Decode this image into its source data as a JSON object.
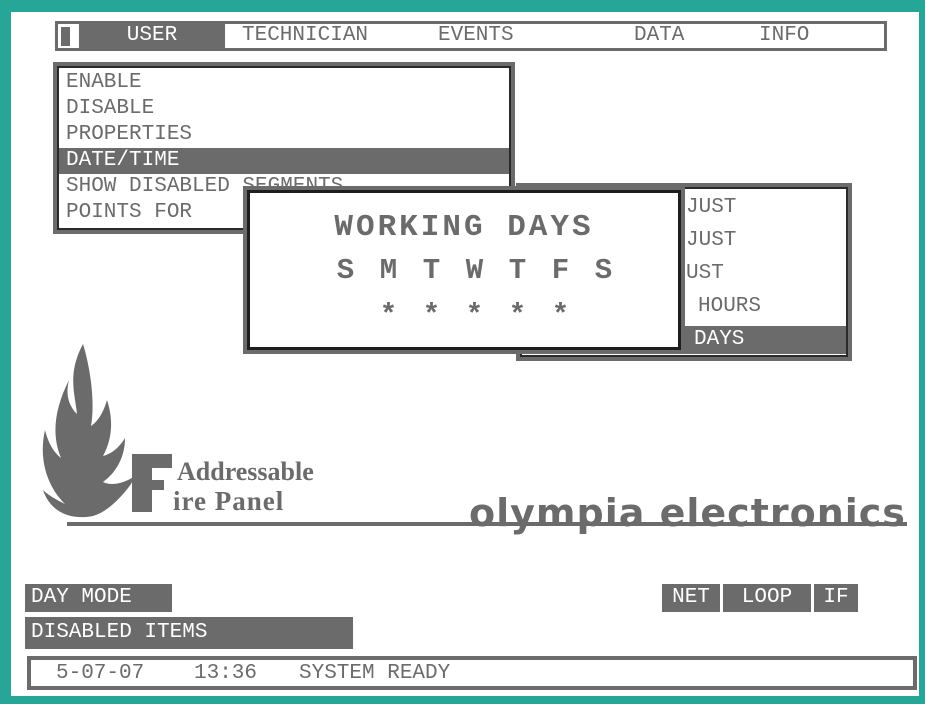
{
  "menu": {
    "items": [
      {
        "label": "USER",
        "active": true
      },
      {
        "label": "TECHNICIAN",
        "active": false
      },
      {
        "label": "EVENTS",
        "active": false
      },
      {
        "label": "DATA",
        "active": false
      },
      {
        "label": "INFO",
        "active": false
      }
    ]
  },
  "user_menu": {
    "items": [
      {
        "label": "ENABLE"
      },
      {
        "label": "DISABLE"
      },
      {
        "label": "PROPERTIES"
      },
      {
        "label": "DATE/TIME",
        "selected": true
      },
      {
        "label": "SHOW DISABLED SEGMENTS"
      },
      {
        "label": "POINTS FOR"
      }
    ]
  },
  "datetime_submenu": {
    "items": [
      {
        "label": "JUST"
      },
      {
        "label": "JUST"
      },
      {
        "label": "UST"
      },
      {
        "label": "HOURS"
      },
      {
        "label": "DAYS",
        "selected": true
      }
    ]
  },
  "working_days_dialog": {
    "title": "WORKING DAYS",
    "days": [
      "S",
      "M",
      "T",
      "W",
      "T",
      "F",
      "S"
    ],
    "marks": [
      "",
      "*",
      "*",
      "*",
      "*",
      "*",
      ""
    ]
  },
  "logo": {
    "product_line1": "Addressable",
    "product_big_f": "F",
    "product_line2": "ire Panel",
    "brand": "olympia electronics"
  },
  "status": {
    "mode": "DAY MODE",
    "disabled": "DISABLED ITEMS",
    "indicators": [
      "NET",
      "LOOP",
      "IF"
    ],
    "date": "5-07-07",
    "time": "13:36",
    "message": "SYSTEM READY"
  },
  "colors": {
    "frame": "#26a696",
    "gray": "#6b6b6b",
    "screen": "#ffffff"
  }
}
